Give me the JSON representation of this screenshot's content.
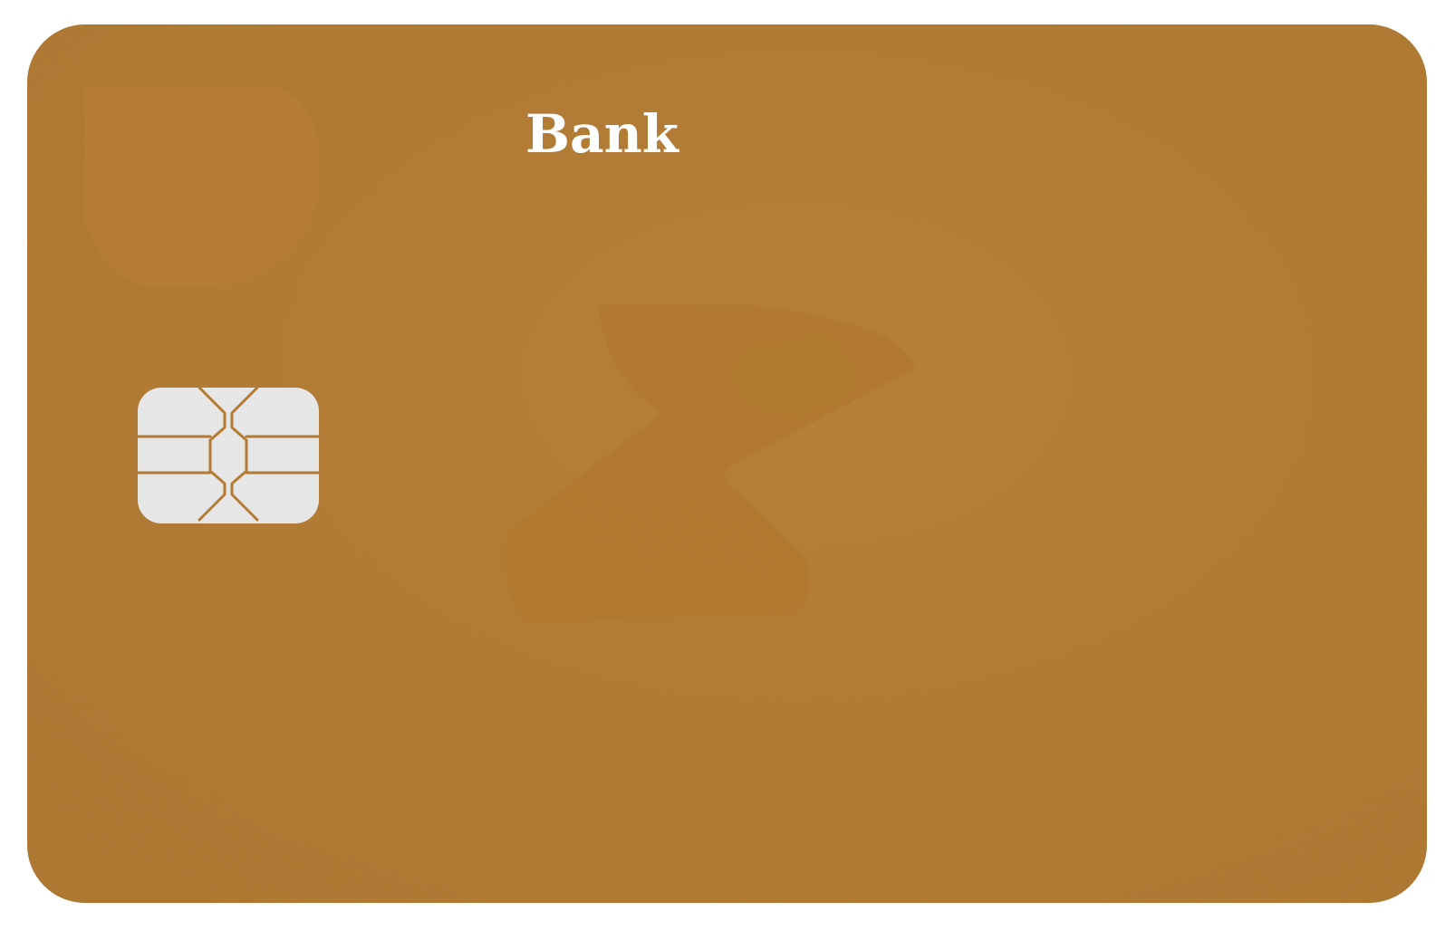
{
  "card": {
    "brand_text": "Bank",
    "background_color": "#b37b33",
    "text_color": "#ffffff",
    "chip_color": "#e6e6e6",
    "logo_icon": "bank-logo-icon",
    "center_icon": "network-mark-icon",
    "chip_icon": "emv-chip-icon"
  }
}
